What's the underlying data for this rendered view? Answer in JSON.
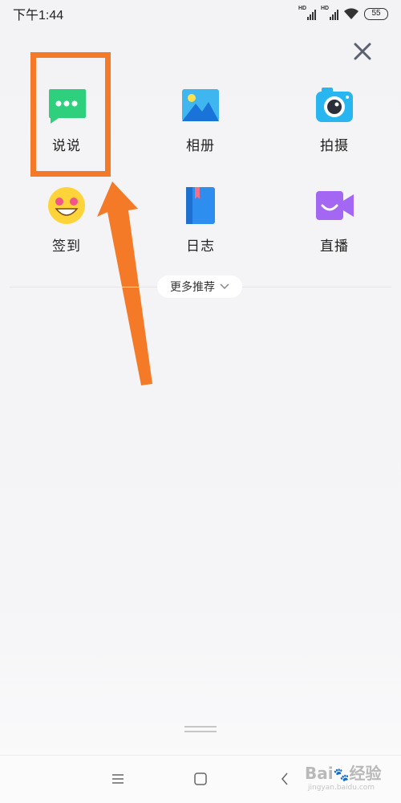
{
  "status_bar": {
    "time": "下午1:44",
    "signal_1_label": "HD",
    "signal_2_label": "HD",
    "battery": "55"
  },
  "panel": {
    "close_icon": "close-icon",
    "items": [
      {
        "label": "说说",
        "icon": "chat-bubble-icon",
        "color": "#2ecf7d"
      },
      {
        "label": "相册",
        "icon": "photo-album-icon",
        "color": "#3fb6ef"
      },
      {
        "label": "拍摄",
        "icon": "camera-icon",
        "color": "#28b6f0"
      },
      {
        "label": "签到",
        "icon": "smiley-icon",
        "color": "#ffd43a"
      },
      {
        "label": "日志",
        "icon": "journal-book-icon",
        "color": "#2d8ef0"
      },
      {
        "label": "直播",
        "icon": "video-camera-icon",
        "color": "#a467f3"
      }
    ],
    "more_label": "更多推荐"
  },
  "annotation": {
    "highlight_color": "#f47a28"
  },
  "nav_bar": {
    "menu_icon": "menu-icon",
    "home_icon": "home-square-icon",
    "back_icon": "back-chevron-icon"
  },
  "watermark": {
    "main": "Bai",
    "main2": "经验",
    "sub": "jingyan.baidu.com"
  }
}
